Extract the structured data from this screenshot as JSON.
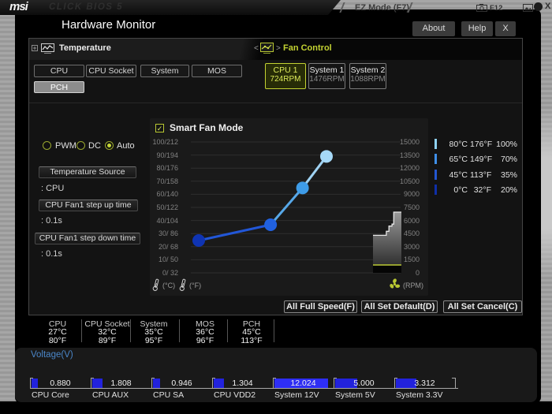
{
  "top_bar": {
    "logo": "msi",
    "product": "CLICK BIOS 5",
    "mode_label": "EZ Mode (F7)",
    "screenshot_hotkey": "F12",
    "close_glyph": "X"
  },
  "dialog": {
    "title": "Hardware Monitor",
    "tabs": {
      "about": "About",
      "help": "Help",
      "close": "X"
    },
    "temperature_section": {
      "label": "Temperature",
      "buttons": [
        {
          "label": "CPU",
          "selected": false
        },
        {
          "label": "CPU Socket",
          "selected": false
        },
        {
          "label": "System",
          "selected": false
        },
        {
          "label": "MOS",
          "selected": false
        },
        {
          "label": "PCH",
          "selected": true
        }
      ]
    },
    "fan_section": {
      "label": "Fan Control",
      "chevron_left": "<",
      "chevron_right": ">",
      "buttons": [
        {
          "name": "CPU 1",
          "rpm": "724RPM",
          "selected": true
        },
        {
          "name": "System 1",
          "rpm": "1476RPM",
          "selected": false
        },
        {
          "name": "System 2",
          "rpm": "1088RPM",
          "selected": false
        }
      ]
    },
    "fan_modes": [
      {
        "label": "PWM",
        "selected": false
      },
      {
        "label": "DC",
        "selected": false
      },
      {
        "label": "Auto",
        "selected": true
      }
    ],
    "fields": [
      {
        "button": "Temperature Source",
        "value": ": CPU"
      },
      {
        "button": "CPU Fan1 step up time",
        "value": ": 0.1s"
      },
      {
        "button": "CPU Fan1 step down time",
        "value": ": 0.1s"
      }
    ],
    "smart_fan": {
      "label": "Smart Fan Mode",
      "checked": true,
      "check_glyph": "✓"
    },
    "setpoints": [
      {
        "temp_c": "80°C",
        "temp_f": "176°F",
        "percent": "100%",
        "bar_color": "#8ed2f5"
      },
      {
        "temp_c": "65°C",
        "temp_f": "149°F",
        "percent": "70%",
        "bar_color": "#3f8fe8"
      },
      {
        "temp_c": "45°C",
        "temp_f": "113°F",
        "percent": "35%",
        "bar_color": "#2356d0"
      },
      {
        "temp_c": "0°C",
        "temp_f": "32°F",
        "percent": "20%",
        "bar_color": "#0f2fa8"
      }
    ],
    "action_buttons": [
      "All Full Speed(F)",
      "All Set Default(D)",
      "All Set Cancel(C)"
    ]
  },
  "chart_data": {
    "type": "line",
    "title": "Smart Fan Mode",
    "x_axis": "temperature (°C), 0-100",
    "y_axis_left": "temperature °C/°F",
    "y_axis_right": "fan speed RPM, 0-15000",
    "grid": true,
    "y_left_ticks": [
      "100/212",
      "90/194",
      "80/176",
      "70/158",
      "60/140",
      "50/122",
      "40/104",
      "30/ 86",
      "20/ 68",
      "10/ 50",
      "0/ 32"
    ],
    "y_right_ticks": [
      "15000",
      "13500",
      "12000",
      "10500",
      "9000",
      "7500",
      "6000",
      "4500",
      "3000",
      "1500",
      "0"
    ],
    "points": [
      {
        "temp_c": 0,
        "duty_percent": 20
      },
      {
        "temp_c": 45,
        "duty_percent": 35
      },
      {
        "temp_c": 65,
        "duty_percent": 70
      },
      {
        "temp_c": 80,
        "duty_percent": 100
      }
    ],
    "point_colors": [
      "#0f34b3",
      "#2161e0",
      "#3e9ce8",
      "#a6d9f8"
    ],
    "segment_colors": [
      "#2257d8",
      "#57a8e8",
      "#9fd2f2"
    ],
    "history_rpm": {
      "steps": [
        [
          0,
          4300
        ],
        [
          0.47,
          4300
        ],
        [
          0.47,
          4760
        ],
        [
          0.56,
          4760
        ],
        [
          0.56,
          5360
        ],
        [
          0.67,
          5360
        ],
        [
          0.67,
          5580
        ],
        [
          0.73,
          5580
        ],
        [
          0.73,
          6960
        ],
        [
          1,
          6960
        ]
      ],
      "current_rpm": 724,
      "current_color": "#b9c832"
    },
    "unit_left_c": "(°C)",
    "unit_left_f": "(°F)",
    "unit_right": "(RPM)"
  },
  "status": {
    "temperatures": [
      {
        "label": "CPU",
        "c": "27°C",
        "f": "80°F"
      },
      {
        "label": "CPU Socket",
        "c": "32°C",
        "f": "89°F"
      },
      {
        "label": "System",
        "c": "35°C",
        "f": "95°F"
      },
      {
        "label": "MOS",
        "c": "36°C",
        "f": "96°F"
      },
      {
        "label": "PCH",
        "c": "45°C",
        "f": "113°F"
      }
    ],
    "voltage": {
      "label": "Voltage(V)",
      "rails": [
        {
          "name": "CPU Core",
          "value": "0.880"
        },
        {
          "name": "CPU AUX",
          "value": "1.808"
        },
        {
          "name": "CPU SA",
          "value": "0.946"
        },
        {
          "name": "CPU VDD2",
          "value": "1.304"
        },
        {
          "name": "System 12V",
          "value": "12.024"
        },
        {
          "name": "System 5V",
          "value": "5.000"
        },
        {
          "name": "System 3.3V",
          "value": "3.312"
        }
      ]
    }
  },
  "colors": {
    "accent_green": "#c3d232",
    "voltage_fill": "#2222dd",
    "voltage_fill_bright": "#2e2ef5",
    "link_blue": "#4a86c8"
  }
}
